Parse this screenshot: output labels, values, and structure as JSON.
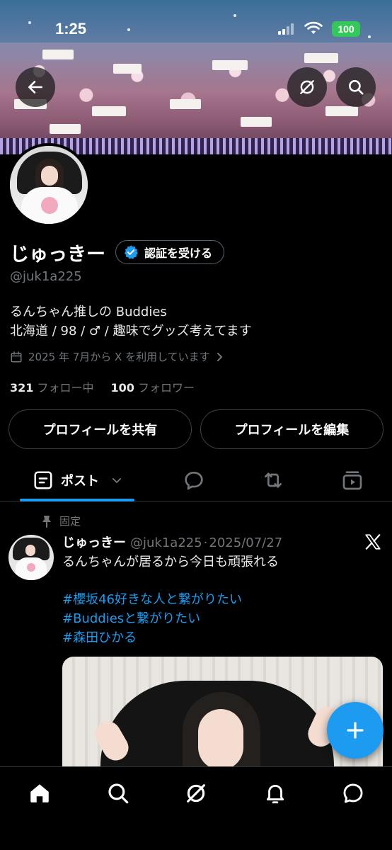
{
  "status_bar": {
    "time": "1:25",
    "battery": "100"
  },
  "profile": {
    "name": "じゅっきー",
    "verify_label": "認証を受ける",
    "handle": "@juk1a225",
    "bio_lines": [
      "るんちゃん推しの Buddies",
      "北海道 / 98 / ♂ / 趣味でグッズ考えてます"
    ],
    "joined": "2025 年 7月から X を利用しています",
    "following_count": "321",
    "following_label": "フォロー中",
    "followers_count": "100",
    "followers_label": "フォロワー",
    "share_button": "プロフィールを共有",
    "edit_button": "プロフィールを編集"
  },
  "tabs": {
    "posts_label": "ポスト"
  },
  "post": {
    "pinned_label": "固定",
    "author_name": "じゅっきー",
    "author_handle": "@juk1a225",
    "separator": "·",
    "date": "2025/07/27",
    "text": "るんちゃんが居るから今日も頑張れる",
    "hashtags": [
      "#櫻坂46好きな人と繋がりたい",
      "#Buddiesと繋がりたい",
      "#森田ひかる"
    ]
  },
  "colors": {
    "accent": "#1d9bf0",
    "secondary_text": "#71767b",
    "background": "#000000",
    "battery": "#34c759"
  },
  "icons": {
    "top_bar": [
      "back-arrow-icon",
      "grok-icon",
      "search-icon"
    ],
    "tabs": [
      "posts-icon",
      "chevron-down-icon",
      "replies-icon",
      "repost-icon",
      "media-icon"
    ],
    "bottom_nav": [
      "home-icon",
      "search-icon",
      "grok-icon",
      "notifications-icon",
      "messages-icon"
    ]
  }
}
